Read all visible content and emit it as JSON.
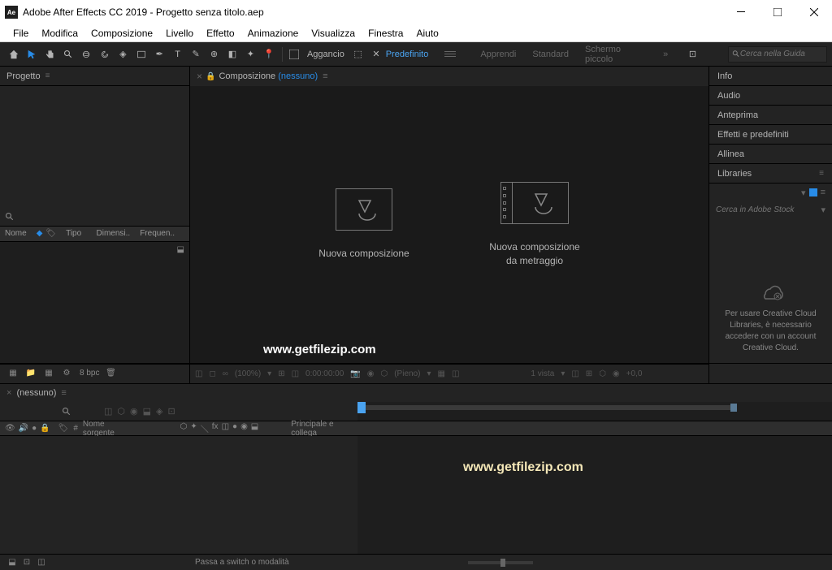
{
  "titlebar": {
    "app_icon": "Ae",
    "title": "Adobe After Effects CC 2019 - Progetto senza titolo.aep"
  },
  "menubar": {
    "items": [
      "File",
      "Modifica",
      "Composizione",
      "Livello",
      "Effetto",
      "Animazione",
      "Visualizza",
      "Finestra",
      "Aiuto"
    ]
  },
  "toolbar": {
    "snap_label": "Aggancio",
    "workspaces": {
      "active": "Predefinito",
      "items": [
        "Apprendi",
        "Standard",
        "Schermo piccolo"
      ]
    },
    "search_placeholder": "Cerca nella Guida"
  },
  "project_panel": {
    "tab_label": "Progetto",
    "columns": {
      "name": "Nome",
      "type": "Tipo",
      "size": "Dimensi..",
      "freq": "Frequen.."
    }
  },
  "comp_panel": {
    "tab_prefix": "Composizione",
    "tab_none": "(nessuno)",
    "card1": "Nuova composizione",
    "card2_line1": "Nuova composizione",
    "card2_line2": "da metraggio"
  },
  "right_panel": {
    "items": [
      "Info",
      "Audio",
      "Anteprima",
      "Effetti e predefiniti",
      "Allinea",
      "Libraries"
    ],
    "lib_search": "Cerca in Adobe Stock",
    "cc_message": "Per usare Creative Cloud Libraries, è necessario accedere con un account Creative Cloud."
  },
  "bottom_toolbar": {
    "bpc": "8 bpc"
  },
  "comp_toolbar": {
    "zoom": "(100%)",
    "time": "0:00:00:00",
    "quality": "(Pieno)",
    "view": "1 vista",
    "exposure": "+0,0"
  },
  "timeline": {
    "tab_none": "(nessuno)",
    "header": {
      "num": "#",
      "source": "Nome sorgente",
      "parent": "Principale e collega"
    }
  },
  "statusbar": {
    "hint": "Passa a switch o modalità"
  },
  "watermark": "www.getfilezip.com"
}
